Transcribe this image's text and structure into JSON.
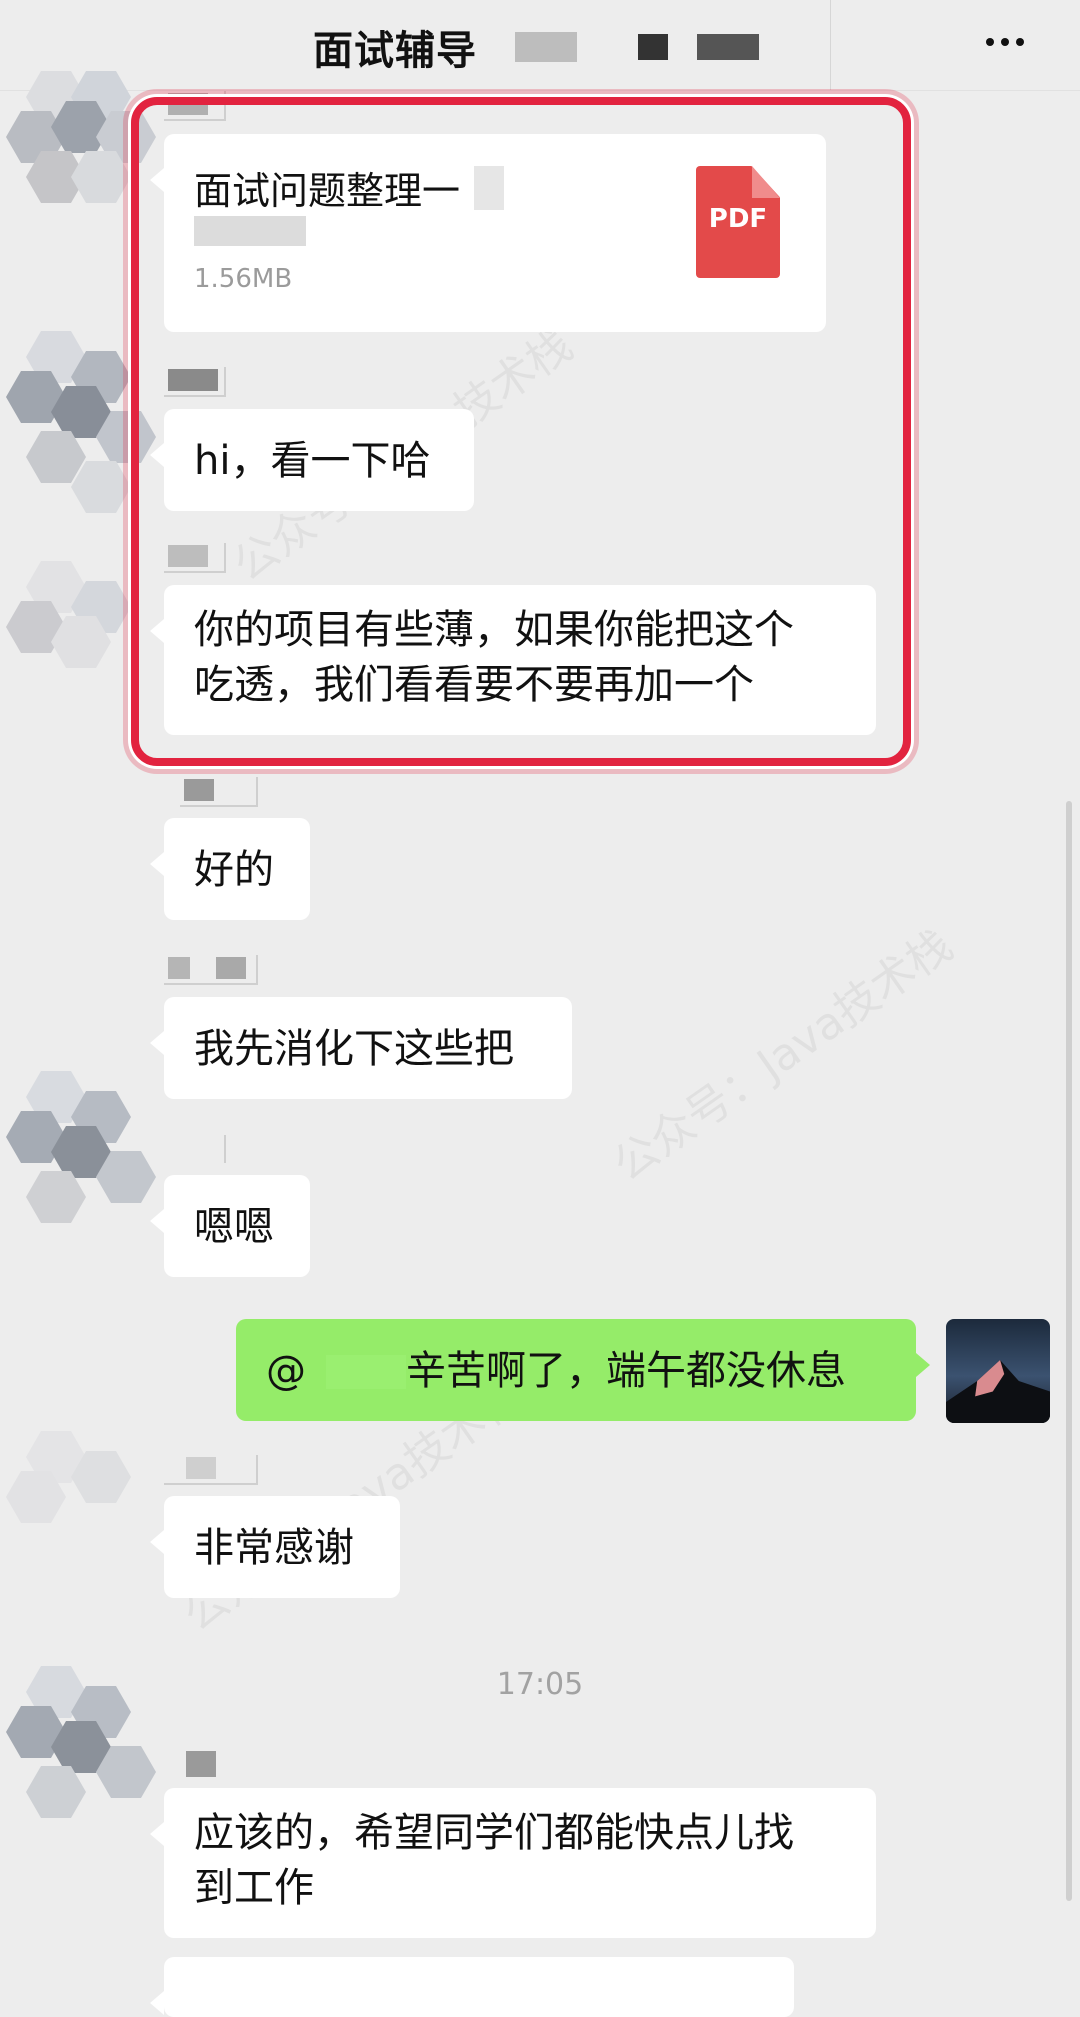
{
  "header": {
    "title": "面试辅导",
    "more_icon": "more-horizontal-icon"
  },
  "messages": {
    "file": {
      "name": "面试问题整理一",
      "size": "1.56MB",
      "icon_label": "PDF",
      "icon": "pdf-file-icon",
      "icon_color": "#e34a4a"
    },
    "m1": "hi，看一下哈",
    "m2_line1": "你的项目有些薄，如果你能把这个",
    "m2_line2": "吃透，我们看看要不要再加一个",
    "m3": "好的",
    "m4": "我先消化下这些把",
    "m5": "嗯嗯",
    "m6_prefix": "@",
    "m6_text": "辛苦啊了，端午都没休息",
    "m7": "非常感谢",
    "timestamp": "17:05",
    "m8_line1": "应该的，希望同学们都能快点儿找",
    "m8_line2": "到工作"
  },
  "colors": {
    "background": "#ededed",
    "bubble_incoming": "#ffffff",
    "bubble_outgoing": "#95ec69",
    "highlight_border": "#e2233f"
  },
  "watermark": {
    "text": "公众号：Java技术栈"
  }
}
